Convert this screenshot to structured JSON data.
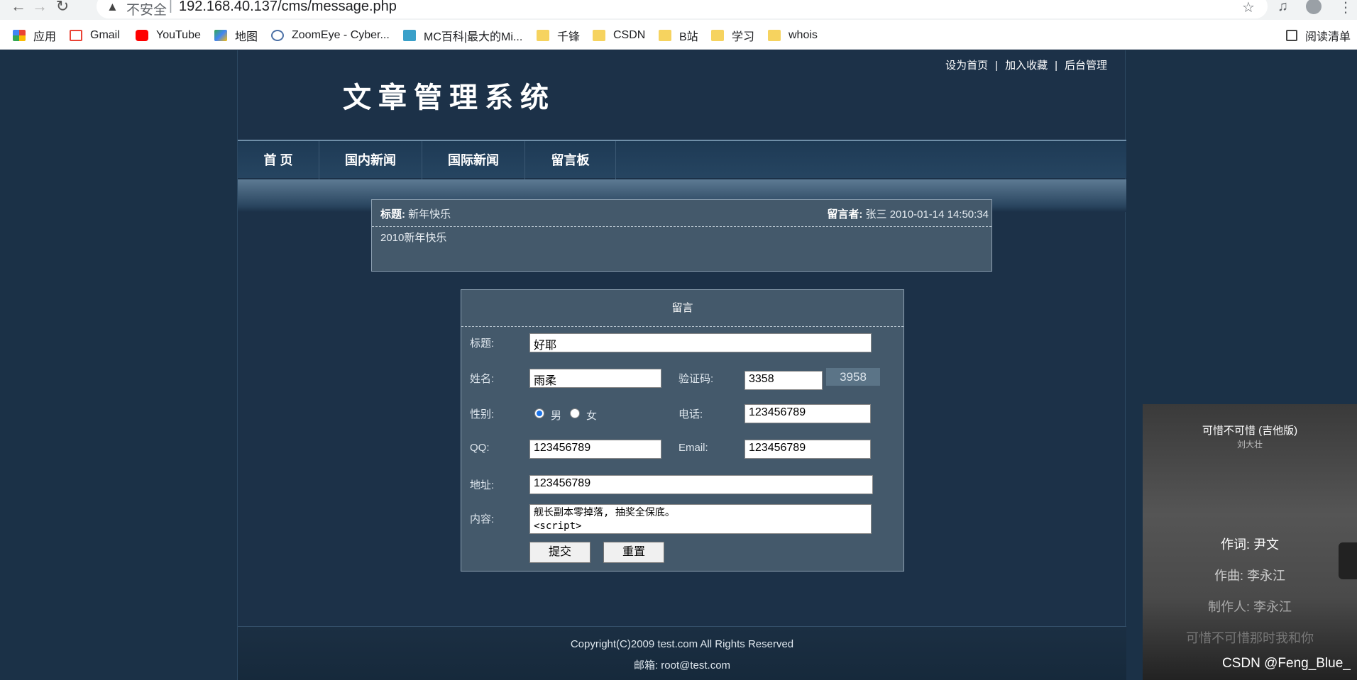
{
  "browser": {
    "insecure_label": "不安全",
    "url": "192.168.40.137/cms/message.php",
    "bookmarks": [
      {
        "label": "应用",
        "icon": "apps-grid-icon"
      },
      {
        "label": "Gmail",
        "icon": "gmail-icon"
      },
      {
        "label": "YouTube",
        "icon": "youtube-icon"
      },
      {
        "label": "地图",
        "icon": "maps-icon"
      },
      {
        "label": "ZoomEye - Cyber...",
        "icon": "zoomeye-icon"
      },
      {
        "label": "MC百科|最大的Mi...",
        "icon": "mc-icon"
      },
      {
        "label": "千锋",
        "icon": "folder-icon"
      },
      {
        "label": "CSDN",
        "icon": "folder-icon"
      },
      {
        "label": "B站",
        "icon": "folder-icon"
      },
      {
        "label": "学习",
        "icon": "folder-icon"
      },
      {
        "label": "whois",
        "icon": "folder-icon"
      }
    ],
    "reading_list": "阅读清单"
  },
  "site": {
    "top_links": [
      "设为首页",
      "加入收藏",
      "后台管理"
    ],
    "separator": "|",
    "logo": "文章管理系统",
    "nav": [
      "首 页",
      "国内新闻",
      "国际新闻",
      "留言板"
    ]
  },
  "message": {
    "title_label": "标题:",
    "title": "新年快乐",
    "author_label": "留言者:",
    "author": "张三",
    "time": "2010-01-14 14:50:34",
    "body": "2010新年快乐"
  },
  "form": {
    "heading": "留言",
    "title_label": "标题:",
    "title_value": "好耶",
    "name_label": "姓名:",
    "name_value": "雨柔",
    "captcha_label": "验证码:",
    "captcha_value": "3358",
    "captcha_image": "3958",
    "gender_label": "性别:",
    "male": "男",
    "female": "女",
    "phone_label": "电话:",
    "phone_value": "123456789",
    "qq_label": "QQ:",
    "qq_value": "123456789",
    "email_label": "Email:",
    "email_value": "123456789",
    "address_label": "地址:",
    "address_value": "123456789",
    "content_label": "内容:",
    "content_line1": "舰长副本零掉落, 抽奖全保底。",
    "content_line2": "<script>",
    "submit": "提交",
    "reset": "重置"
  },
  "footer": {
    "copyright": "Copyright(C)2009 test.com All Rights Reserved",
    "email": "邮箱: root@test.com"
  },
  "music": {
    "song": "可惜不可惜 (吉他版)",
    "artist": "刘大壮",
    "lyricist": "作词: 尹文",
    "composer": "作曲: 李永江",
    "producer": "制作人: 李永江",
    "lyric": "可惜不可惜那时我和你"
  },
  "watermark": "CSDN @Feng_Blue_"
}
